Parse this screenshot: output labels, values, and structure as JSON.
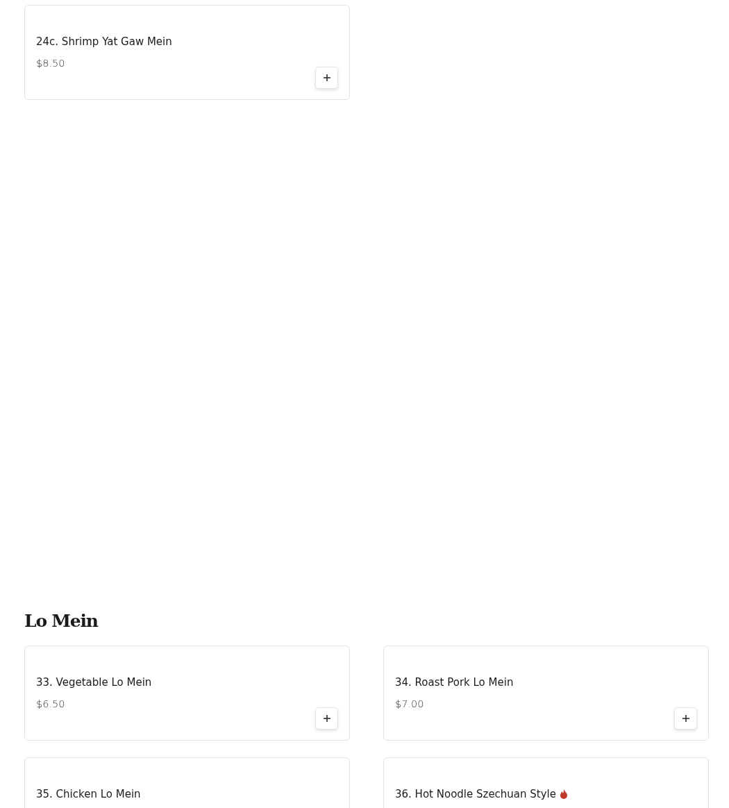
{
  "sections": [
    {
      "items": [
        {
          "name": "24c. Shrimp Yat Gaw Mein",
          "price": "$8.50",
          "spicy": false
        }
      ]
    },
    {
      "title": "Lo Mein",
      "items": [
        {
          "name": "33. Vegetable Lo Mein",
          "price": "$6.50",
          "spicy": false
        },
        {
          "name": "34. Roast Pork Lo Mein",
          "price": "$7.00",
          "spicy": false
        },
        {
          "name": "35. Chicken Lo Mein",
          "spicy": false
        },
        {
          "name": "36. Hot Noodle Szechuan Style",
          "spicy": true
        }
      ]
    }
  ]
}
